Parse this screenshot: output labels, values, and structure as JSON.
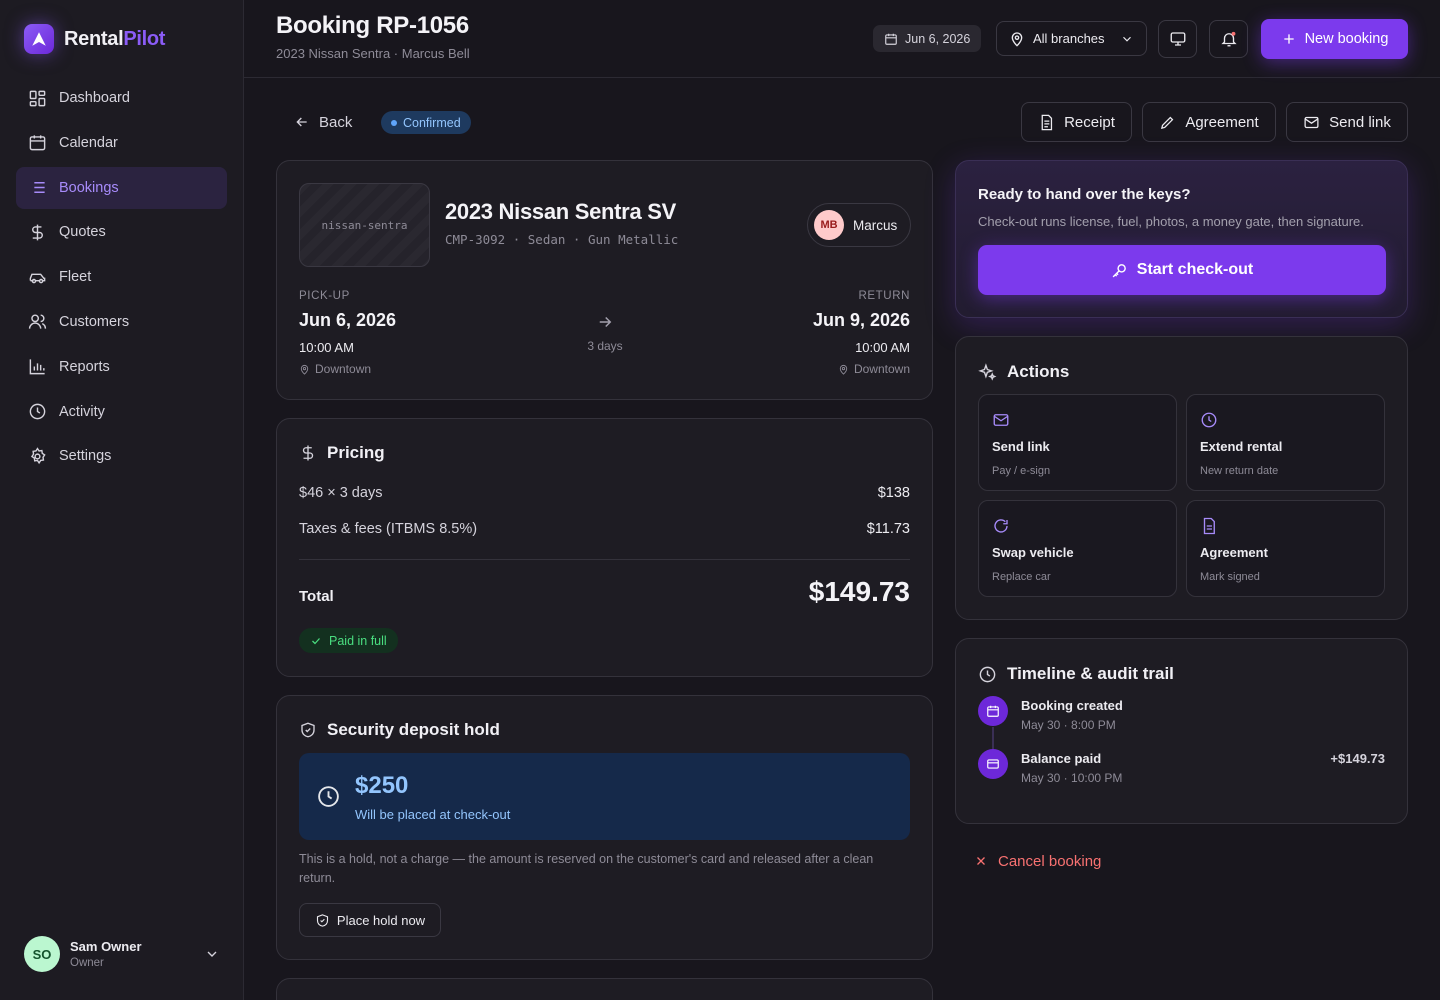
{
  "brand": {
    "name_a": "Rental",
    "name_b": "Pilot"
  },
  "sidebar": {
    "items": [
      {
        "label": "Dashboard",
        "icon": "grid-icon"
      },
      {
        "label": "Calendar",
        "icon": "calendar-icon"
      },
      {
        "label": "Bookings",
        "icon": "list-icon",
        "active": true
      },
      {
        "label": "Quotes",
        "icon": "dollar-icon"
      },
      {
        "label": "Fleet",
        "icon": "car-icon"
      },
      {
        "label": "Customers",
        "icon": "users-icon"
      },
      {
        "label": "Reports",
        "icon": "bar-chart-icon"
      },
      {
        "label": "Activity",
        "icon": "clock-icon"
      },
      {
        "label": "Settings",
        "icon": "gear-icon"
      }
    ],
    "user": {
      "initials": "SO",
      "name": "Sam Owner",
      "role": "Owner"
    }
  },
  "header": {
    "title": "Booking RP-1056",
    "subtitle": "2023 Nissan Sentra · Marcus Bell",
    "date": "Jun 6, 2026",
    "branch": "All branches",
    "new_booking": "New booking"
  },
  "toolbar": {
    "back": "Back",
    "status": "Confirmed",
    "receipt": "Receipt",
    "agreement": "Agreement",
    "send_link": "Send link"
  },
  "vehicle": {
    "thumb_label": "nissan-sentra",
    "title": "2023 Nissan Sentra SV",
    "meta": "CMP-3092  ·  Sedan  ·  Gun Metallic",
    "customer_initials": "MB",
    "customer_name": "Marcus",
    "pickup_label": "PICK-UP",
    "pickup_date": "Jun 6, 2026",
    "pickup_time": "10:00 AM",
    "pickup_location": "Downtown",
    "duration": "3 days",
    "return_label": "RETURN",
    "return_date": "Jun 9, 2026",
    "return_time": "10:00 AM",
    "return_location": "Downtown"
  },
  "pricing": {
    "title": "Pricing",
    "line1_label": "$46 × 3 days",
    "line1_value": "$138",
    "line2_label": "Taxes & fees (ITBMS 8.5%)",
    "line2_value": "$11.73",
    "total_label": "Total",
    "total_value": "$149.73",
    "paid_badge": "Paid in full"
  },
  "deposit": {
    "title": "Security deposit hold",
    "amount": "$250",
    "subtitle": "Will be placed at check-out",
    "note": "This is a hold, not a charge — the amount is reserved on the customer's card and released after a clean return.",
    "button": "Place hold now"
  },
  "checkout": {
    "title": "Ready to hand over the keys?",
    "subtitle": "Check-out runs license, fuel, photos, a money gate, then signature.",
    "button": "Start check-out"
  },
  "actions": {
    "title": "Actions",
    "items": [
      {
        "title": "Send link",
        "sub": "Pay / e-sign",
        "icon": "mail-icon"
      },
      {
        "title": "Extend rental",
        "sub": "New return date",
        "icon": "clock-icon"
      },
      {
        "title": "Swap vehicle",
        "sub": "Replace car",
        "icon": "refresh-icon"
      },
      {
        "title": "Agreement",
        "sub": "Mark signed",
        "icon": "document-icon"
      }
    ]
  },
  "timeline": {
    "title": "Timeline & audit trail",
    "events": [
      {
        "title": "Booking created",
        "time": "May 30 · 8:00 PM",
        "amount": "",
        "icon": "calendar-icon"
      },
      {
        "title": "Balance paid",
        "time": "May 30 · 10:00 PM",
        "amount": "+$149.73",
        "icon": "credit-card-icon"
      }
    ]
  },
  "cancel": "Cancel booking",
  "colors": {
    "accent": "#7c3aed",
    "accent_light": "#a78bfa",
    "success": "#4ade80",
    "danger": "#f87171",
    "info": "#93c5fd"
  }
}
